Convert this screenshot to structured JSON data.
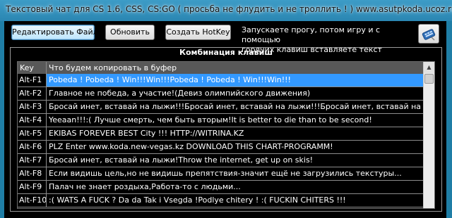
{
  "window": {
    "title": "Текстовый чат для CS 1.6, CSS, CS:GO ( просьба не флудить и не троллить ! ) www.asutpkoda.ucoz.ru"
  },
  "toolbar": {
    "edit_file": "Редактировать Файл",
    "refresh": "Обновить",
    "create_hotkey": "Создать HotKey",
    "hint_line1": "Запускаете прогу, потом игру и с помощью",
    "hint_line2": "горячих клавиш вставляете текст"
  },
  "group": {
    "title": "Комбинация клавиш"
  },
  "table": {
    "headers": [
      "Key",
      "Что будем копировать в буфер"
    ],
    "rows": [
      {
        "key": "Alt-F1",
        "text": "Pobeda ! Pobeda ! Win!!!Win!!!Pobeda ! Pobeda ! Win!!!Win!!!"
      },
      {
        "key": "Alt-F2",
        "text": "Главное не победа, а участие!(Девиз олимпийского движения)"
      },
      {
        "key": "Alt-F3",
        "text": "Бросай инет, вставай на лыжи!!!Бросай инет, вставай на лыжи!!!Бросай инет, вставай на лыжи!!!"
      },
      {
        "key": "Alt-F4",
        "text": "Yeeaan!!!:( Лучше смерть, чем быть вторым!It is better to die than to be second!"
      },
      {
        "key": "Alt-F5",
        "text": "EKIBAS FOREVER BEST City !!! HTTP://WITRINA.KZ"
      },
      {
        "key": "Alt-F6",
        "text": "PLZ Enter www.koda.new-vegas.kz DOWNLOAD THIS CHART-PROGRAMM!"
      },
      {
        "key": "Alt-F7",
        "text": "Бросай инет, вставай на лыжи!Throw the internet, get up on skis!"
      },
      {
        "key": "Alt-F8",
        "text": "Если видишь цель,но не видишь препятствия-значит ещё не загрузились текстуры..."
      },
      {
        "key": "Alt-F9",
        "text": " Палач не знает роздыха,Работа-то с людьми..."
      },
      {
        "key": "Alt-F10",
        "text": ":( WATS A FUCK ? Da da Tak i Vsegda !Podlye chitery ! :( FUCKIN CHITERS !!!"
      }
    ],
    "selected_index": 0
  },
  "icons": {
    "hotkey_icon": "keyboard-icon",
    "scroll_up": "scroll-up-arrow-icon"
  },
  "colors": {
    "selection": "#3399ff",
    "background": "#000000",
    "titlebar": "#2a86b2"
  }
}
